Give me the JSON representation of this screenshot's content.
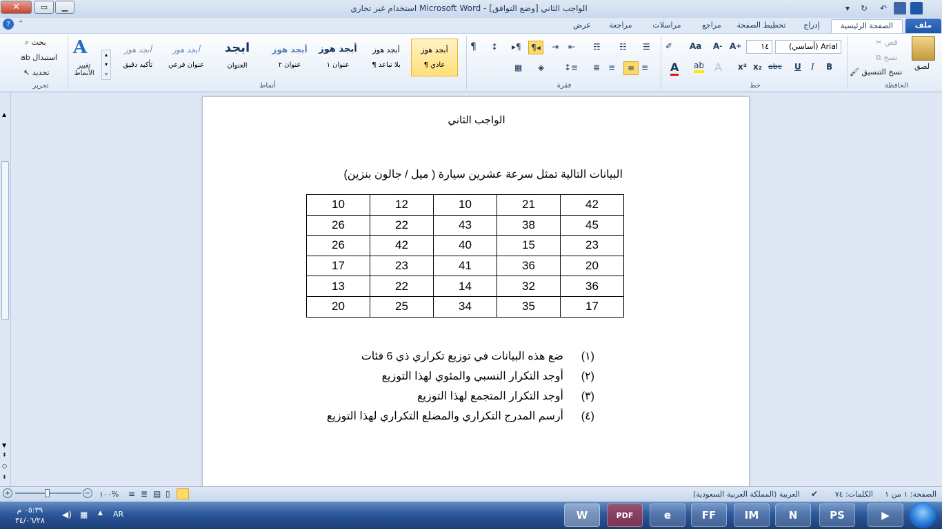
{
  "window": {
    "title": "الواجب الثاني [وضع التوافق] - Microsoft Word استخدام غير تجاري"
  },
  "tabs": [
    "ملف",
    "الصفحة الرئيسية",
    "إدراج",
    "تخطيط الصفحة",
    "مراجع",
    "مراسلات",
    "مراجعة",
    "عرض"
  ],
  "clipboard": {
    "paste": "لصق",
    "cut": "قص",
    "copy": "نسخ",
    "format_painter": "نسخ التنسيق",
    "group": "الحافظة"
  },
  "font": {
    "name": "Arial (أساسي)",
    "size": "١٤",
    "group": "خط",
    "grow": "A",
    "shrink": "A",
    "case": "Aa"
  },
  "paragraph": {
    "group": "فقرة"
  },
  "styles": {
    "items": [
      {
        "preview": "أبجد هوز",
        "label": "¶ عادي"
      },
      {
        "preview": "أبجد هوز",
        "label": "¶ بلا تباعد"
      },
      {
        "preview": "أبجد هوز",
        "label": "عنوان ١"
      },
      {
        "preview": "أبجد هوز",
        "label": "عنوان ٢"
      },
      {
        "preview": "ابجد",
        "label": "العنوان"
      },
      {
        "preview": "أبجد هوز",
        "label": "عنوان فرعي"
      },
      {
        "preview": "أبجد هوز",
        "label": "تأكيد دقيق"
      }
    ],
    "change": "تغيير الأنماط",
    "group": "أنماط"
  },
  "editing": {
    "find": "بحث",
    "replace": "استبدال",
    "select": "تحديد",
    "group": "تحرير"
  },
  "document": {
    "title": "الواجب الثاني",
    "intro": "البيانات التالية تمثل سرعة عشرين سيارة ( ميل / جالون بنزين)",
    "table": [
      [
        "10",
        "12",
        "10",
        "21",
        "42"
      ],
      [
        "26",
        "22",
        "43",
        "38",
        "45"
      ],
      [
        "26",
        "42",
        "40",
        "15",
        "23"
      ],
      [
        "17",
        "23",
        "41",
        "36",
        "20"
      ],
      [
        "13",
        "22",
        "14",
        "32",
        "36"
      ],
      [
        "20",
        "25",
        "34",
        "35",
        "17"
      ]
    ],
    "questions": [
      {
        "num": "(١)",
        "text": "ضع هذه البيانات في توزيع تكراري ذي  6 فئات"
      },
      {
        "num": "(٢)",
        "text": "أوجد التكرار النسبي والمئوي لهذا التوزيع"
      },
      {
        "num": "(٣)",
        "text": "أوجد التكرار المتجمع  لهذا التوزيع"
      },
      {
        "num": "(٤)",
        "text": "أرسم المدرج التكراري والمضلع التكراري لهذا التوزيع"
      }
    ]
  },
  "status": {
    "page": "الصفحة: ١ من ١",
    "words": "الكلمات: ٧٤",
    "language": "العربية (المملكة العربية السعودية)",
    "zoom": "١٠٠%"
  },
  "taskbar": {
    "lang": "AR",
    "time": "٠٥:٣٩ م",
    "date": "٣٤/٠٦/٢٨",
    "apps": [
      "W",
      "PDF",
      "e",
      "FF",
      "IM",
      "N",
      "PS",
      "▶"
    ]
  }
}
